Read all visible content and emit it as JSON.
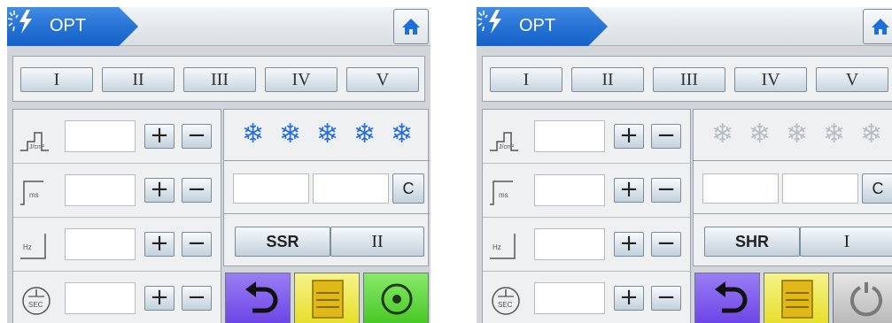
{
  "panels": [
    {
      "header": {
        "mode_label": "OPT",
        "mode_icon": "lightning-burst-icon",
        "home_icon": "home-icon"
      },
      "tabs": [
        {
          "label": "I"
        },
        {
          "label": "II"
        },
        {
          "label": "III"
        },
        {
          "label": "IV"
        },
        {
          "label": "V"
        }
      ],
      "controls": [
        {
          "icon": "fluence-icon",
          "icon_text": "J/cm²",
          "value": "",
          "plus": "+",
          "minus": "−"
        },
        {
          "icon": "pulse-width-icon",
          "icon_text": "ms",
          "value": "",
          "plus": "+",
          "minus": "−"
        },
        {
          "icon": "frequency-icon",
          "icon_text": "Hz",
          "value": "",
          "plus": "+",
          "minus": "−"
        },
        {
          "icon": "timer-icon",
          "icon_text": "SEC",
          "value": "",
          "plus": "+",
          "minus": "−"
        }
      ],
      "cooling": {
        "glyph": "❄",
        "active_color": "#2a6fd6",
        "levels_total": 5,
        "levels_active": 5
      },
      "inputs": {
        "field_a": "",
        "field_b": "",
        "clear_label": "C"
      },
      "mode": {
        "label": "SSR",
        "pulse_label": "II"
      },
      "actions": {
        "back_icon": "undo-arrow-icon",
        "save_icon": "floppy-disk-icon",
        "start_icon": "power-ready-icon",
        "start_state": "on"
      }
    },
    {
      "header": {
        "mode_label": "OPT",
        "mode_icon": "lightning-burst-icon",
        "home_icon": "home-icon"
      },
      "tabs": [
        {
          "label": "I"
        },
        {
          "label": "II"
        },
        {
          "label": "III"
        },
        {
          "label": "IV"
        },
        {
          "label": "V"
        }
      ],
      "controls": [
        {
          "icon": "fluence-icon",
          "icon_text": "J/cm²",
          "value": "",
          "plus": "+",
          "minus": "−"
        },
        {
          "icon": "pulse-width-icon",
          "icon_text": "ms",
          "value": "",
          "plus": "+",
          "minus": "−"
        },
        {
          "icon": "frequency-icon",
          "icon_text": "Hz",
          "value": "",
          "plus": "+",
          "minus": "−"
        },
        {
          "icon": "timer-icon",
          "icon_text": "SEC",
          "value": "",
          "plus": "+",
          "minus": "−"
        }
      ],
      "cooling": {
        "glyph": "❄",
        "active_color": "#b8bec4",
        "levels_total": 5,
        "levels_active": 0
      },
      "inputs": {
        "field_a": "",
        "field_b": "",
        "clear_label": "C"
      },
      "mode": {
        "label": "SHR",
        "pulse_label": "I"
      },
      "actions": {
        "back_icon": "undo-arrow-icon",
        "save_icon": "floppy-disk-icon",
        "start_icon": "power-standby-icon",
        "start_state": "off"
      }
    }
  ]
}
